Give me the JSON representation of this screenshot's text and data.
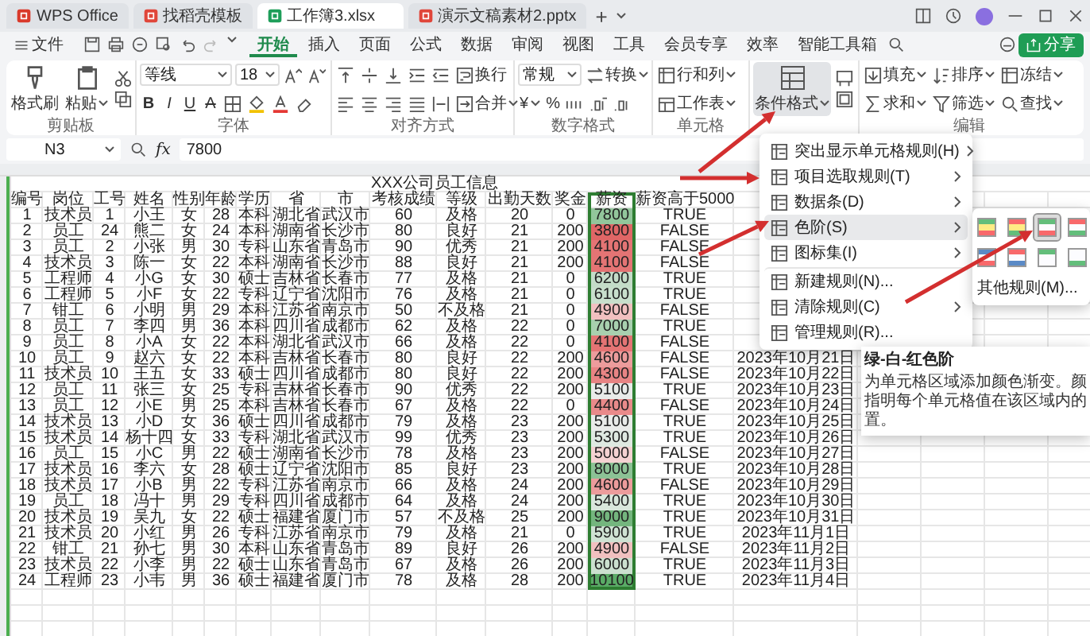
{
  "titlebar": {
    "tabs": [
      {
        "label": "WPS Office",
        "kind": "home",
        "selected": false
      },
      {
        "label": "找稻壳模板",
        "kind": "template",
        "selected": false
      },
      {
        "label": "工作簿3.xlsx",
        "kind": "spreadsheet",
        "selected": true
      },
      {
        "label": "演示文稿素材2.pptx",
        "kind": "presentation",
        "selected": false
      }
    ],
    "new_tab": "+"
  },
  "menubar": {
    "file": "文件",
    "tabs": [
      {
        "label": "开始",
        "selected": true
      },
      {
        "label": "插入",
        "selected": false
      },
      {
        "label": "页面",
        "selected": false
      },
      {
        "label": "公式",
        "selected": false
      },
      {
        "label": "数据",
        "selected": false
      },
      {
        "label": "审阅",
        "selected": false
      },
      {
        "label": "视图",
        "selected": false
      },
      {
        "label": "工具",
        "selected": false
      },
      {
        "label": "会员专享",
        "selected": false
      },
      {
        "label": "效率",
        "selected": false
      },
      {
        "label": "智能工具箱",
        "selected": false
      }
    ],
    "share": "分享"
  },
  "ribbon": {
    "clipboard": {
      "format_painter": "格式刷",
      "paste": "粘贴",
      "caption": "剪贴板"
    },
    "font": {
      "name": "等线",
      "size": "18",
      "bold": "B",
      "italic": "I",
      "underline": "U",
      "strike": "A",
      "caption": "字体"
    },
    "alignment": {
      "wrap": "换行",
      "merge": "合并",
      "caption": "对齐方式"
    },
    "number": {
      "format": "常规",
      "convert": "转换",
      "currency": "¥",
      "percent": "%",
      "caption": "数字格式"
    },
    "cells": {
      "rows_cols": "行和列",
      "worksheet": "工作表",
      "caption": "单元格"
    },
    "conditional": {
      "label": "条件格式",
      "active": true
    },
    "editing": {
      "fill": "填充",
      "sort": "排序",
      "freeze": "冻结",
      "sum": "求和",
      "filter": "筛选",
      "find": "查找",
      "caption": "编辑"
    }
  },
  "formula_bar": {
    "cell": "N3",
    "fx": "fx",
    "value": "7800"
  },
  "sheet": {
    "title": "XXX公司员工信息",
    "columns": [
      {
        "label": "编号",
        "selected": false
      },
      {
        "label": "岗位",
        "selected": false
      },
      {
        "label": "工号",
        "selected": false
      },
      {
        "label": "姓名",
        "selected": false
      },
      {
        "label": "性别",
        "selected": false
      },
      {
        "label": "年龄",
        "selected": false
      },
      {
        "label": "学历",
        "selected": false
      },
      {
        "label": "省",
        "selected": false
      },
      {
        "label": "市",
        "selected": false
      },
      {
        "label": "考核成绩",
        "selected": false
      },
      {
        "label": "等级",
        "selected": false
      },
      {
        "label": "出勤天数",
        "selected": false
      },
      {
        "label": "奖金",
        "selected": false
      },
      {
        "label": "薪资",
        "selected": true
      },
      {
        "label": "薪资高于5000",
        "selected": false
      }
    ],
    "rows": [
      {
        "cells": [
          "1",
          "技术员",
          "1",
          "小王",
          "女",
          "28",
          "本科",
          "湖北省",
          "武汉市",
          "60",
          "及格",
          "20",
          "0",
          "7800",
          "TRUE"
        ],
        "color": "#92c69b"
      },
      {
        "cells": [
          "2",
          "员工",
          "24",
          "熊二",
          "女",
          "24",
          "本科",
          "湖南省",
          "长沙市",
          "80",
          "良好",
          "21",
          "200",
          "3800",
          "FALSE"
        ],
        "color": "#e06666"
      },
      {
        "cells": [
          "3",
          "员工",
          "2",
          "小张",
          "男",
          "30",
          "专科",
          "山东省",
          "青岛市",
          "90",
          "优秀",
          "21",
          "200",
          "4100",
          "FALSE"
        ],
        "color": "#e47474"
      },
      {
        "cells": [
          "4",
          "技术员",
          "3",
          "陈一",
          "女",
          "22",
          "本科",
          "湖南省",
          "长沙市",
          "88",
          "良好",
          "21",
          "200",
          "4100",
          "FALSE"
        ],
        "color": "#e47474"
      },
      {
        "cells": [
          "5",
          "工程师",
          "4",
          "小G",
          "女",
          "30",
          "硕士",
          "吉林省",
          "长春市",
          "77",
          "及格",
          "21",
          "0",
          "6200",
          "TRUE"
        ],
        "color": "#c4dcc8"
      },
      {
        "cells": [
          "6",
          "工程师",
          "5",
          "小F",
          "女",
          "22",
          "专科",
          "辽宁省",
          "沈阳市",
          "76",
          "及格",
          "21",
          "0",
          "6100",
          "TRUE"
        ],
        "color": "#c8dfcc"
      },
      {
        "cells": [
          "7",
          "钳工",
          "6",
          "小明",
          "男",
          "29",
          "本科",
          "江苏省",
          "南京市",
          "50",
          "不及格",
          "21",
          "0",
          "4900",
          "FALSE"
        ],
        "color": "#f1c0c0"
      },
      {
        "cells": [
          "8",
          "员工",
          "7",
          "李四",
          "男",
          "36",
          "本科",
          "四川省",
          "成都市",
          "62",
          "及格",
          "22",
          "0",
          "7000",
          "TRUE"
        ],
        "color": "#a8d0af"
      },
      {
        "cells": [
          "9",
          "员工",
          "8",
          "小A",
          "女",
          "22",
          "本科",
          "湖北省",
          "武汉市",
          "66",
          "及格",
          "22",
          "0",
          "4100",
          "FALSE"
        ],
        "color": "#e47474"
      },
      {
        "cells": [
          "10",
          "员工",
          "9",
          "赵六",
          "女",
          "22",
          "本科",
          "吉林省",
          "长春市",
          "80",
          "良好",
          "22",
          "200",
          "4600",
          "FALSE"
        ],
        "color": "#ec9c9c",
        "date": "2023年10月21日"
      },
      {
        "cells": [
          "11",
          "技术员",
          "10",
          "王五",
          "女",
          "33",
          "硕士",
          "四川省",
          "成都市",
          "80",
          "良好",
          "22",
          "200",
          "4300",
          "FALSE"
        ],
        "color": "#e88484",
        "date": "2023年10月22日"
      },
      {
        "cells": [
          "12",
          "员工",
          "11",
          "张三",
          "女",
          "25",
          "专科",
          "吉林省",
          "长春市",
          "90",
          "优秀",
          "22",
          "200",
          "5100",
          "TRUE"
        ],
        "color": "#e9ebe9",
        "date": "2023年10月23日"
      },
      {
        "cells": [
          "13",
          "员工",
          "12",
          "小E",
          "男",
          "25",
          "本科",
          "吉林省",
          "长春市",
          "67",
          "及格",
          "22",
          "0",
          "4400",
          "FALSE"
        ],
        "color": "#e98a8a",
        "date": "2023年10月24日"
      },
      {
        "cells": [
          "14",
          "技术员",
          "13",
          "小D",
          "女",
          "36",
          "硕士",
          "四川省",
          "成都市",
          "79",
          "及格",
          "23",
          "200",
          "5100",
          "TRUE"
        ],
        "color": "#e9ebe9",
        "date": "2023年10月25日"
      },
      {
        "cells": [
          "15",
          "技术员",
          "14",
          "杨十四",
          "女",
          "33",
          "专科",
          "湖北省",
          "武汉市",
          "99",
          "优秀",
          "23",
          "200",
          "5300",
          "TRUE"
        ],
        "color": "#dfe9e1",
        "date": "2023年10月26日"
      },
      {
        "cells": [
          "16",
          "员工",
          "15",
          "小C",
          "男",
          "22",
          "硕士",
          "湖南省",
          "长沙市",
          "78",
          "及格",
          "23",
          "200",
          "5000",
          "FALSE"
        ],
        "color": "#f4d2d2",
        "date": "2023年10月27日"
      },
      {
        "cells": [
          "17",
          "技术员",
          "16",
          "李六",
          "女",
          "28",
          "硕士",
          "辽宁省",
          "沈阳市",
          "85",
          "良好",
          "23",
          "200",
          "8000",
          "TRUE"
        ],
        "color": "#8cc295",
        "date": "2023年10月28日"
      },
      {
        "cells": [
          "18",
          "技术员",
          "17",
          "小B",
          "男",
          "22",
          "专科",
          "江苏省",
          "南京市",
          "66",
          "及格",
          "24",
          "200",
          "4600",
          "FALSE"
        ],
        "color": "#ec9c9c",
        "date": "2023年10月29日"
      },
      {
        "cells": [
          "19",
          "员工",
          "18",
          "冯十",
          "男",
          "29",
          "专科",
          "四川省",
          "成都市",
          "64",
          "及格",
          "24",
          "200",
          "5400",
          "TRUE"
        ],
        "color": "#d9e7dc",
        "date": "2023年10月30日"
      },
      {
        "cells": [
          "20",
          "技术员",
          "19",
          "吴九",
          "女",
          "22",
          "硕士",
          "福建省",
          "厦门市",
          "57",
          "不及格",
          "25",
          "200",
          "9000",
          "TRUE"
        ],
        "color": "#74b67e",
        "date": "2023年10月31日"
      },
      {
        "cells": [
          "21",
          "技术员",
          "20",
          "小红",
          "男",
          "26",
          "专科",
          "江苏省",
          "南京市",
          "79",
          "及格",
          "21",
          "0",
          "5900",
          "TRUE"
        ],
        "color": "#cfe2d3",
        "date": "2023年11月1日"
      },
      {
        "cells": [
          "22",
          "钳工",
          "21",
          "孙七",
          "男",
          "30",
          "本科",
          "山东省",
          "青岛市",
          "89",
          "良好",
          "26",
          "200",
          "4900",
          "FALSE"
        ],
        "color": "#f1c0c0",
        "date": "2023年11月2日"
      },
      {
        "cells": [
          "23",
          "技术员",
          "22",
          "小李",
          "男",
          "22",
          "硕士",
          "山东省",
          "青岛市",
          "67",
          "及格",
          "26",
          "200",
          "6000",
          "TRUE"
        ],
        "color": "#cbe0cf",
        "date": "2023年11月3日"
      },
      {
        "cells": [
          "24",
          "工程师",
          "23",
          "小韦",
          "男",
          "36",
          "硕士",
          "福建省",
          "厦门市",
          "78",
          "及格",
          "28",
          "200",
          "10100",
          "TRUE"
        ],
        "color": "#5aab66",
        "date": "2023年11月4日"
      }
    ]
  },
  "cf_menu": {
    "items": [
      {
        "label": "突出显示单元格规则(H)",
        "submenu": true,
        "selected": false,
        "group_start": false
      },
      {
        "label": "项目选取规则(T)",
        "submenu": true,
        "selected": false,
        "group_start": false
      },
      {
        "label": "数据条(D)",
        "submenu": true,
        "selected": false,
        "group_start": false
      },
      {
        "label": "色阶(S)",
        "submenu": true,
        "selected": true,
        "group_start": false
      },
      {
        "label": "图标集(I)",
        "submenu": true,
        "selected": false,
        "group_start": false
      },
      {
        "label": "新建规则(N)...",
        "submenu": false,
        "selected": false,
        "group_start": true
      },
      {
        "label": "清除规则(C)",
        "submenu": true,
        "selected": false,
        "group_start": false
      },
      {
        "label": "管理规则(R)...",
        "submenu": false,
        "selected": false,
        "group_start": false
      }
    ]
  },
  "cf_submenu": {
    "swatches": [
      {
        "selected": false
      },
      {
        "selected": false
      },
      {
        "selected": true
      },
      {
        "selected": false
      },
      {
        "selected": false
      },
      {
        "selected": false
      },
      {
        "selected": false
      },
      {
        "selected": false
      }
    ],
    "more": "其他规则(M)..."
  },
  "tooltip": {
    "title": "绿-白-红色阶",
    "lines": [
      "为单元格区域添加颜色渐变。颜",
      "指明每个单元格值在该区域内的",
      "置。"
    ]
  }
}
